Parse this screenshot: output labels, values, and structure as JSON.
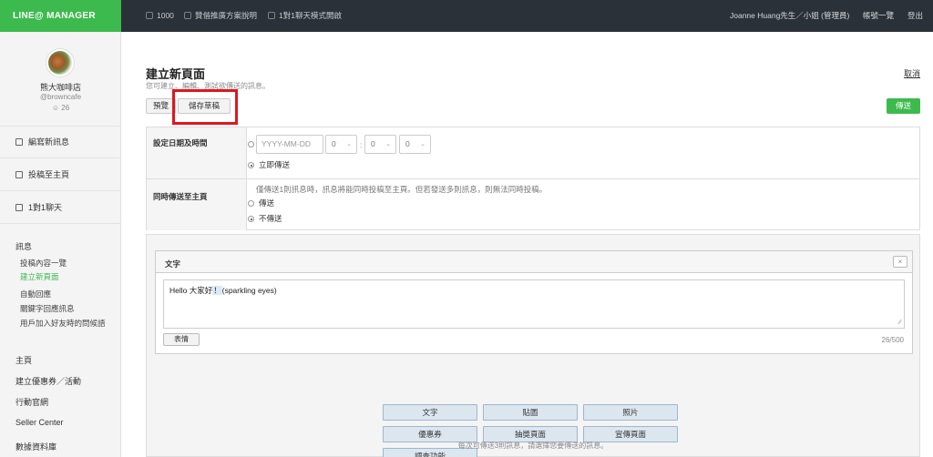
{
  "topbar": {
    "logo": "LINE@ MANAGER",
    "points": "1000",
    "promo_link": "贊偕推廣方案說明",
    "chat_mode_link": "1對1聊天模式開啟",
    "user": "Joanne Huang先生／小姐 (管理員)",
    "accounts_link": "帳號一覽",
    "logout_link": "登出"
  },
  "sidebar": {
    "shop_name": "熊大咖啡店",
    "shop_id": "@browncafe",
    "friends_count": "26",
    "main_items": [
      {
        "label": "編寫新訊息",
        "icon": "speaker-icon"
      },
      {
        "label": "投稿至主頁",
        "icon": "edit-icon"
      },
      {
        "label": "1對1聊天",
        "icon": "chat-icon"
      }
    ],
    "message_section": {
      "title": "訊息",
      "items": [
        {
          "label": "投稿內容一覽",
          "active": false
        },
        {
          "label": "建立新頁面",
          "active": true
        },
        {
          "label": "自動回應",
          "active": false
        },
        {
          "label": "關鍵字回應訊息",
          "active": false
        },
        {
          "label": "用戶加入好友時的問候語",
          "active": false
        }
      ]
    },
    "other_items": [
      {
        "label": "主頁"
      },
      {
        "label": "建立優惠券／活動"
      },
      {
        "label": "行動官網"
      },
      {
        "label": "Seller Center"
      },
      {
        "label": "數據資料庫"
      }
    ]
  },
  "main": {
    "title": "建立新頁面",
    "subtitle": "您可建立、編輯、測試欲傳送的訊息。",
    "cancel_label": "取消",
    "preview_label": "預覽",
    "save_draft_label": "儲存草稿",
    "send_label": "傳送"
  },
  "schedule": {
    "label": "設定日期及時間",
    "date_placeholder": "YYYY-MM-DD",
    "hour_value": "0",
    "minute_value": "0",
    "second_value": "0",
    "send_now_label": "立即傳送"
  },
  "crosspost": {
    "label": "同時傳送至主頁",
    "note": "僅傳送1則訊息時，訊息將能同時投稿至主頁。但若發送多則訊息，則無法同時投稿。",
    "option_send": "傳送",
    "option_no_send": "不傳送"
  },
  "composer": {
    "card_title": "文字",
    "close_symbol": "×",
    "text_prefix": "Hello 大家好",
    "text_emoji": "！",
    "text_suffix": "(sparkling eyes)",
    "emoticon_label": "表情",
    "char_count": "26/500",
    "type_buttons": [
      "文字",
      "貼圖",
      "照片",
      "優惠券",
      "抽獎頁面",
      "宣傳頁面",
      "調查功能"
    ],
    "footnote": "每次可傳送3則訊息，請選擇您要傳送的訊息。"
  }
}
